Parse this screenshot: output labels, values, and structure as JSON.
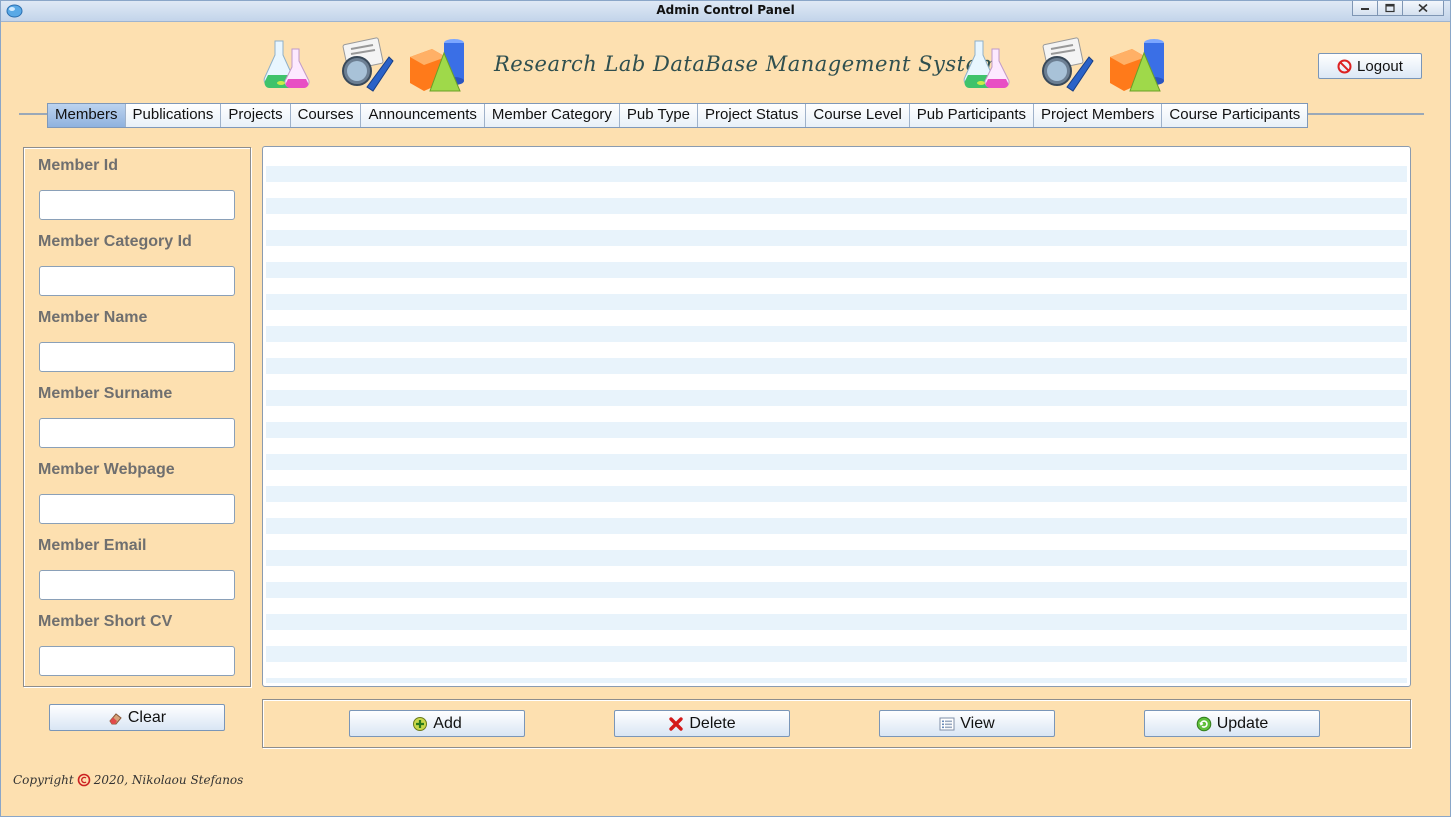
{
  "window": {
    "title": "Admin Control Panel"
  },
  "header": {
    "title": "Research Lab DataBase Management System",
    "logout_label": "Logout"
  },
  "tabs": [
    {
      "label": "Members",
      "active": true
    },
    {
      "label": "Publications"
    },
    {
      "label": "Projects"
    },
    {
      "label": "Courses"
    },
    {
      "label": "Announcements"
    },
    {
      "label": "Member Category"
    },
    {
      "label": "Pub Type"
    },
    {
      "label": "Project Status"
    },
    {
      "label": "Course Level"
    },
    {
      "label": "Pub Participants"
    },
    {
      "label": "Project Members"
    },
    {
      "label": "Course Participants"
    }
  ],
  "form": {
    "fields": [
      {
        "label": "Member Id",
        "value": ""
      },
      {
        "label": "Member Category Id",
        "value": ""
      },
      {
        "label": "Member Name",
        "value": ""
      },
      {
        "label": "Member Surname",
        "value": ""
      },
      {
        "label": "Member Webpage",
        "value": ""
      },
      {
        "label": "Member Email",
        "value": ""
      },
      {
        "label": "Member Short CV",
        "value": ""
      }
    ],
    "clear_label": "Clear"
  },
  "actions": {
    "add_label": "Add",
    "delete_label": "Delete",
    "view_label": "View",
    "update_label": "Update"
  },
  "footer": {
    "copyright_word": "Copyright",
    "copyright_text": "2020, Nikolaou Stefanos"
  },
  "icons": [
    "app-icon",
    "flasks-icon",
    "magnifier-pen-icon",
    "shapes-icon",
    "no-entry-icon",
    "eraser-icon",
    "add-icon",
    "delete-icon",
    "view-icon",
    "update-icon",
    "copyright-icon"
  ]
}
